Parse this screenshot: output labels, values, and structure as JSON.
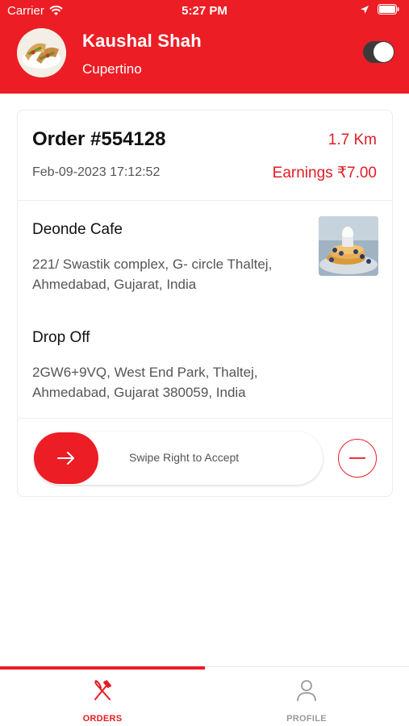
{
  "status_bar": {
    "carrier": "Carrier",
    "time": "5:27 PM",
    "icons": [
      "wifi-icon",
      "location-arrow-icon",
      "battery-icon"
    ]
  },
  "header": {
    "user_name": "Kaushal Shah",
    "city": "Cupertino",
    "online_toggle": true,
    "avatar_icon": "food-avatar-image"
  },
  "order": {
    "number": "Order #554128",
    "distance": "1.7 Km",
    "datetime": "Feb-09-2023 17:12:52",
    "earnings": "Earnings ₹7.00",
    "pickup": {
      "name": "Deonde Cafe",
      "address": "221/ Swastik complex, G- circle Thaltej, Ahmedabad, Gujarat, India",
      "image_icon": "pancakes-thumbnail"
    },
    "drop": {
      "label": "Drop Off",
      "address": "2GW6+9VQ, West End Park, Thaltej, Ahmedabad, Gujarat 380059, India"
    },
    "swipe": {
      "label": "Swipe Right to Accept",
      "handle_icon": "arrow-right-icon"
    },
    "decline_icon": "minus-circle-icon"
  },
  "tabs": [
    {
      "label": "ORDERS",
      "icon": "fork-knife-icon",
      "active": true
    },
    {
      "label": "PROFILE",
      "icon": "user-icon",
      "active": false
    }
  ],
  "colors": {
    "brand_red": "#ec1d24",
    "text_dark": "#111111",
    "text_muted": "#555555",
    "tab_inactive": "#9a9a9a"
  }
}
